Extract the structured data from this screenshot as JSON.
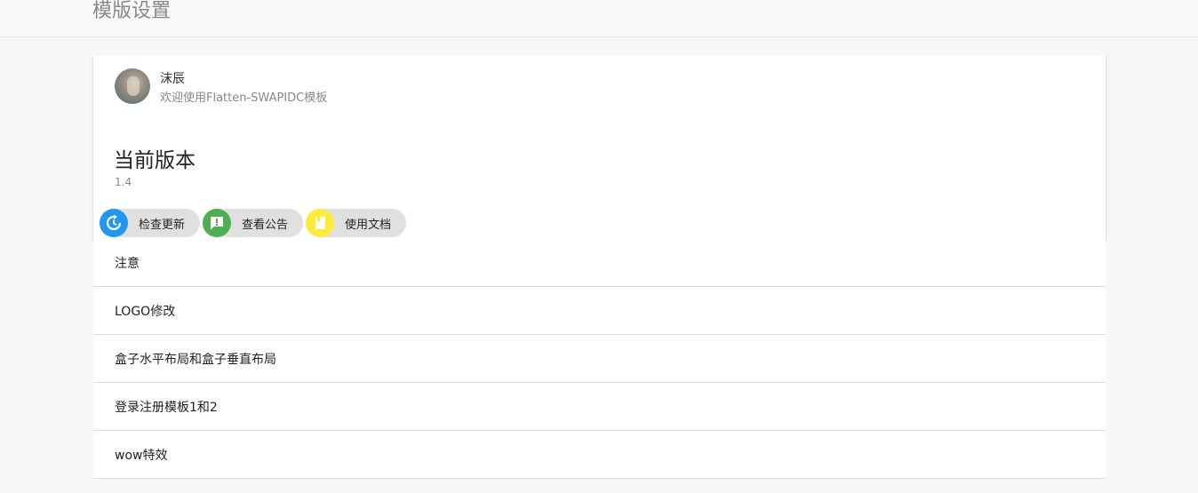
{
  "header": {
    "title": "模版设置"
  },
  "user": {
    "name": "沫辰",
    "subtitle": "欢迎使用Flatten-SWAPIDC模板"
  },
  "version": {
    "heading": "当前版本",
    "number": "1.4"
  },
  "actions": [
    {
      "label": "检查更新",
      "icon": "refresh-icon",
      "color": "#2196f3"
    },
    {
      "label": "查看公告",
      "icon": "announcement-icon",
      "color": "#4caf50"
    },
    {
      "label": "使用文档",
      "icon": "document-icon",
      "color": "#ffeb3b"
    }
  ],
  "sections": [
    {
      "label": "注意"
    },
    {
      "label": "LOGO修改"
    },
    {
      "label": "盒子水平布局和盒子垂直布局"
    },
    {
      "label": "登录注册模板1和2"
    },
    {
      "label": "wow特效"
    }
  ]
}
